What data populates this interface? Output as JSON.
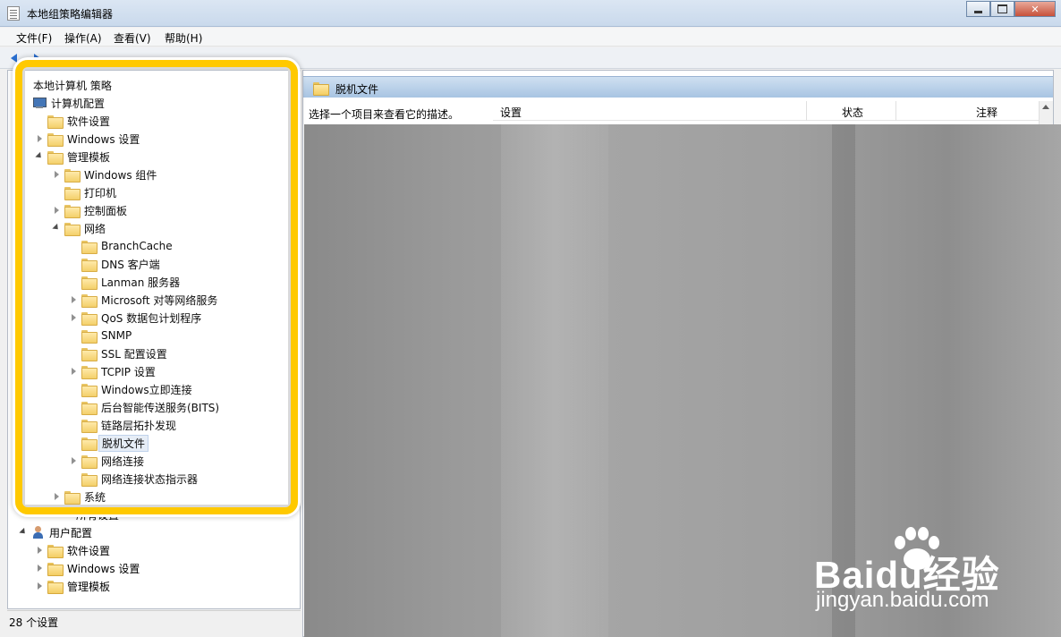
{
  "window": {
    "title": "本地组策略编辑器"
  },
  "menu": [
    "文件(F)",
    "操作(A)",
    "查看(V)",
    "帮助(H)"
  ],
  "tree": {
    "root": "本地计算机 策略",
    "computer_config": "计算机配置",
    "software_settings": "软件设置",
    "windows_settings": "Windows 设置",
    "admin_templates": "管理模板",
    "windows_components": "Windows 组件",
    "printers": "打印机",
    "control_panel": "控制面板",
    "network": "网络",
    "network_items": [
      "BranchCache",
      "DNS 客户端",
      "Lanman 服务器",
      "Microsoft 对等网络服务",
      "QoS 数据包计划程序",
      "SNMP",
      "SSL 配置设置",
      "TCPIP 设置",
      "Windows立即连接",
      "后台智能传送服务(BITS)",
      "链路层拓扑发现",
      "脱机文件",
      "网络连接",
      "网络连接状态指示器"
    ],
    "system": "系统",
    "all_settings": "所有设置",
    "user_config": "用户配置",
    "user_software_settings": "软件设置",
    "user_windows_settings": "Windows 设置",
    "user_admin_templates": "管理模板"
  },
  "right_pane": {
    "folder_title": "脱机文件",
    "description": "选择一个项目来查看它的描述。",
    "columns": [
      "设置",
      "状态",
      "注释"
    ]
  },
  "status": {
    "text": "28 个设置"
  },
  "watermark": {
    "main": "Baidu经验",
    "sub": "jingyan.baidu.com"
  }
}
